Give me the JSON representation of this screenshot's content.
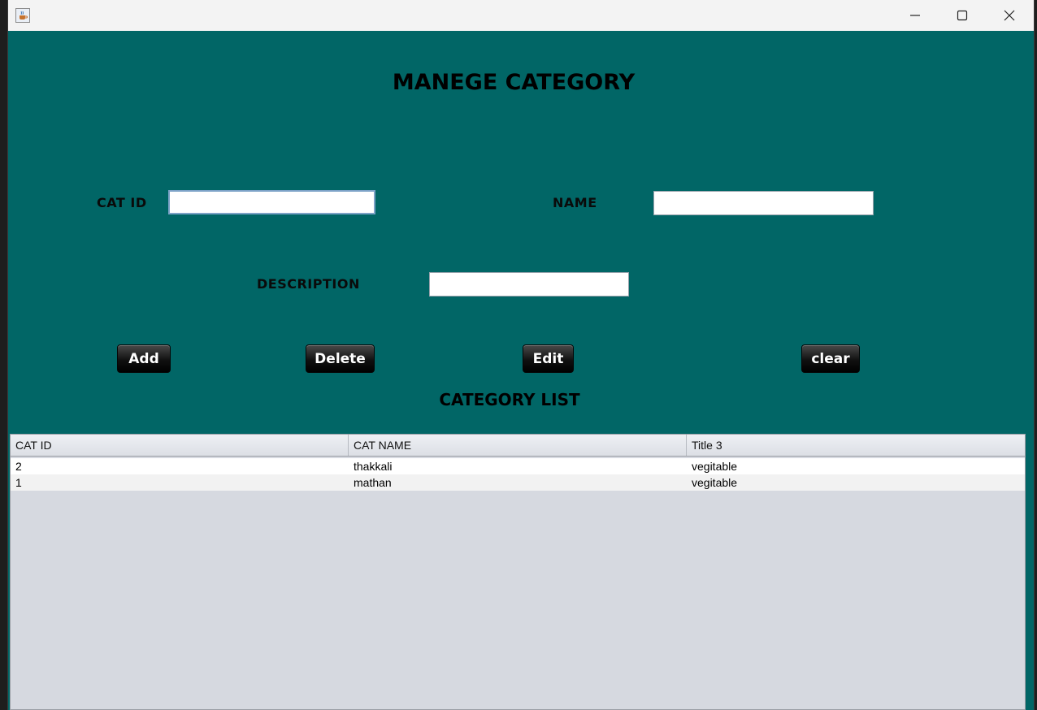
{
  "header": {
    "title": "MANEGE CATEGORY"
  },
  "form": {
    "cat_id_label": "CAT ID",
    "cat_id_value": "",
    "name_label": "NAME",
    "name_value": "",
    "description_label": "DESCRIPTION",
    "description_value": ""
  },
  "buttons": {
    "add": "Add",
    "delete": "Delete",
    "edit": "Edit",
    "clear": "clear"
  },
  "list": {
    "title": "CATEGORY LIST",
    "columns": [
      "CAT ID",
      "CAT NAME",
      "Title 3"
    ],
    "rows": [
      [
        "2",
        "thakkali",
        "vegitable"
      ],
      [
        "1",
        "mathan",
        "vegitable"
      ]
    ]
  },
  "colors": {
    "background": "#016666",
    "button": "#111111"
  },
  "icons": {
    "app": "java-cup-icon",
    "minimize": "minimize-icon",
    "maximize": "maximize-icon",
    "close": "close-icon"
  }
}
